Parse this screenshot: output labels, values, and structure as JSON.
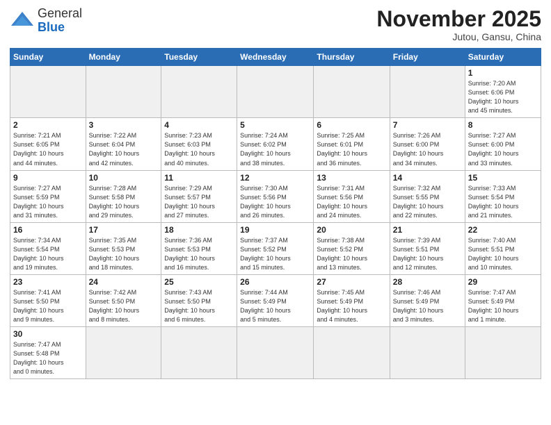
{
  "header": {
    "logo_general": "General",
    "logo_blue": "Blue",
    "month_title": "November 2025",
    "subtitle": "Jutou, Gansu, China"
  },
  "days_of_week": [
    "Sunday",
    "Monday",
    "Tuesday",
    "Wednesday",
    "Thursday",
    "Friday",
    "Saturday"
  ],
  "weeks": [
    [
      {
        "day": "",
        "info": ""
      },
      {
        "day": "",
        "info": ""
      },
      {
        "day": "",
        "info": ""
      },
      {
        "day": "",
        "info": ""
      },
      {
        "day": "",
        "info": ""
      },
      {
        "day": "",
        "info": ""
      },
      {
        "day": "1",
        "info": "Sunrise: 7:20 AM\nSunset: 6:06 PM\nDaylight: 10 hours\nand 45 minutes."
      }
    ],
    [
      {
        "day": "2",
        "info": "Sunrise: 7:21 AM\nSunset: 6:05 PM\nDaylight: 10 hours\nand 44 minutes."
      },
      {
        "day": "3",
        "info": "Sunrise: 7:22 AM\nSunset: 6:04 PM\nDaylight: 10 hours\nand 42 minutes."
      },
      {
        "day": "4",
        "info": "Sunrise: 7:23 AM\nSunset: 6:03 PM\nDaylight: 10 hours\nand 40 minutes."
      },
      {
        "day": "5",
        "info": "Sunrise: 7:24 AM\nSunset: 6:02 PM\nDaylight: 10 hours\nand 38 minutes."
      },
      {
        "day": "6",
        "info": "Sunrise: 7:25 AM\nSunset: 6:01 PM\nDaylight: 10 hours\nand 36 minutes."
      },
      {
        "day": "7",
        "info": "Sunrise: 7:26 AM\nSunset: 6:00 PM\nDaylight: 10 hours\nand 34 minutes."
      },
      {
        "day": "8",
        "info": "Sunrise: 7:27 AM\nSunset: 6:00 PM\nDaylight: 10 hours\nand 33 minutes."
      }
    ],
    [
      {
        "day": "9",
        "info": "Sunrise: 7:27 AM\nSunset: 5:59 PM\nDaylight: 10 hours\nand 31 minutes."
      },
      {
        "day": "10",
        "info": "Sunrise: 7:28 AM\nSunset: 5:58 PM\nDaylight: 10 hours\nand 29 minutes."
      },
      {
        "day": "11",
        "info": "Sunrise: 7:29 AM\nSunset: 5:57 PM\nDaylight: 10 hours\nand 27 minutes."
      },
      {
        "day": "12",
        "info": "Sunrise: 7:30 AM\nSunset: 5:56 PM\nDaylight: 10 hours\nand 26 minutes."
      },
      {
        "day": "13",
        "info": "Sunrise: 7:31 AM\nSunset: 5:56 PM\nDaylight: 10 hours\nand 24 minutes."
      },
      {
        "day": "14",
        "info": "Sunrise: 7:32 AM\nSunset: 5:55 PM\nDaylight: 10 hours\nand 22 minutes."
      },
      {
        "day": "15",
        "info": "Sunrise: 7:33 AM\nSunset: 5:54 PM\nDaylight: 10 hours\nand 21 minutes."
      }
    ],
    [
      {
        "day": "16",
        "info": "Sunrise: 7:34 AM\nSunset: 5:54 PM\nDaylight: 10 hours\nand 19 minutes."
      },
      {
        "day": "17",
        "info": "Sunrise: 7:35 AM\nSunset: 5:53 PM\nDaylight: 10 hours\nand 18 minutes."
      },
      {
        "day": "18",
        "info": "Sunrise: 7:36 AM\nSunset: 5:53 PM\nDaylight: 10 hours\nand 16 minutes."
      },
      {
        "day": "19",
        "info": "Sunrise: 7:37 AM\nSunset: 5:52 PM\nDaylight: 10 hours\nand 15 minutes."
      },
      {
        "day": "20",
        "info": "Sunrise: 7:38 AM\nSunset: 5:52 PM\nDaylight: 10 hours\nand 13 minutes."
      },
      {
        "day": "21",
        "info": "Sunrise: 7:39 AM\nSunset: 5:51 PM\nDaylight: 10 hours\nand 12 minutes."
      },
      {
        "day": "22",
        "info": "Sunrise: 7:40 AM\nSunset: 5:51 PM\nDaylight: 10 hours\nand 10 minutes."
      }
    ],
    [
      {
        "day": "23",
        "info": "Sunrise: 7:41 AM\nSunset: 5:50 PM\nDaylight: 10 hours\nand 9 minutes."
      },
      {
        "day": "24",
        "info": "Sunrise: 7:42 AM\nSunset: 5:50 PM\nDaylight: 10 hours\nand 8 minutes."
      },
      {
        "day": "25",
        "info": "Sunrise: 7:43 AM\nSunset: 5:50 PM\nDaylight: 10 hours\nand 6 minutes."
      },
      {
        "day": "26",
        "info": "Sunrise: 7:44 AM\nSunset: 5:49 PM\nDaylight: 10 hours\nand 5 minutes."
      },
      {
        "day": "27",
        "info": "Sunrise: 7:45 AM\nSunset: 5:49 PM\nDaylight: 10 hours\nand 4 minutes."
      },
      {
        "day": "28",
        "info": "Sunrise: 7:46 AM\nSunset: 5:49 PM\nDaylight: 10 hours\nand 3 minutes."
      },
      {
        "day": "29",
        "info": "Sunrise: 7:47 AM\nSunset: 5:49 PM\nDaylight: 10 hours\nand 1 minute."
      }
    ],
    [
      {
        "day": "30",
        "info": "Sunrise: 7:47 AM\nSunset: 5:48 PM\nDaylight: 10 hours\nand 0 minutes."
      },
      {
        "day": "",
        "info": ""
      },
      {
        "day": "",
        "info": ""
      },
      {
        "day": "",
        "info": ""
      },
      {
        "day": "",
        "info": ""
      },
      {
        "day": "",
        "info": ""
      },
      {
        "day": "",
        "info": ""
      }
    ]
  ]
}
